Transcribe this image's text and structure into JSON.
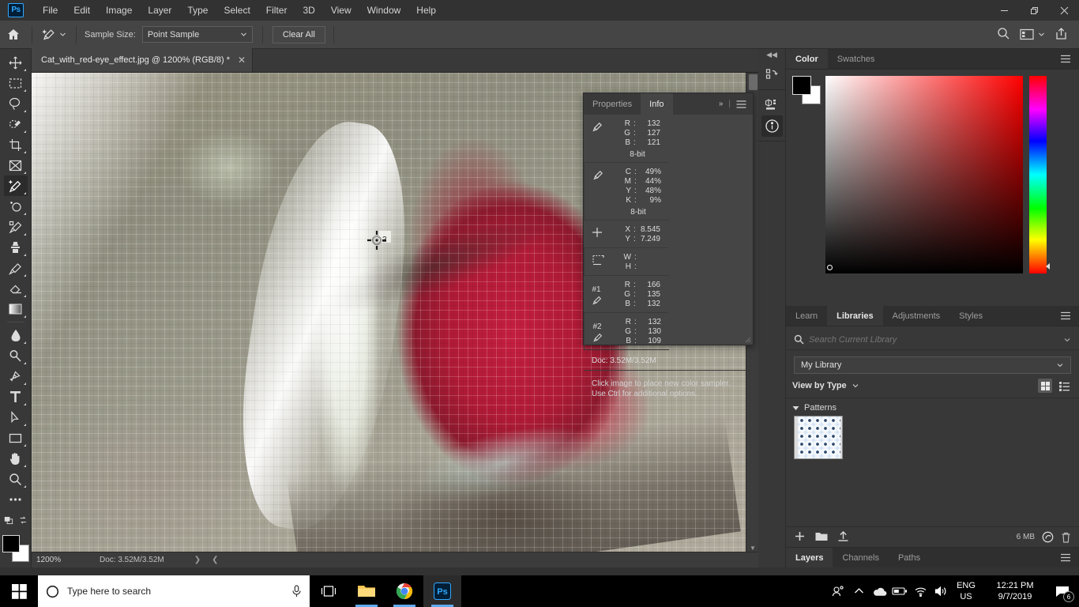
{
  "app": {
    "logo": "Ps",
    "menu": [
      "File",
      "Edit",
      "Image",
      "Layer",
      "Type",
      "Select",
      "Filter",
      "3D",
      "View",
      "Window",
      "Help"
    ],
    "window_buttons": {
      "minimize": "—",
      "restore": "❐",
      "close": "✕"
    }
  },
  "options_bar": {
    "home_icon": "home-icon",
    "tool_icon": "eyedropper-icon",
    "sample_size_label": "Sample Size:",
    "sample_size_value": "Point Sample",
    "clear_all_label": "Clear All",
    "search_icon": "search-icon",
    "workspace_icon": "workspace-icon",
    "share_icon": "share-icon"
  },
  "toolbar": {
    "tools": [
      {
        "name": "move-tool",
        "icon": "move-icon"
      },
      {
        "name": "rectangular-marquee-tool",
        "icon": "marquee-icon"
      },
      {
        "name": "lasso-tool",
        "icon": "lasso-icon"
      },
      {
        "name": "object-selection-tool",
        "icon": "quick-select-icon"
      },
      {
        "name": "crop-tool",
        "icon": "crop-icon"
      },
      {
        "name": "frame-tool",
        "icon": "frame-icon"
      },
      {
        "name": "eyedropper-tool",
        "icon": "eyedropper-icon",
        "active": true
      },
      {
        "name": "spot-healing-brush-tool",
        "icon": "healing-icon"
      },
      {
        "name": "brush-tool",
        "icon": "brush-icon"
      },
      {
        "name": "clone-stamp-tool",
        "icon": "stamp-icon"
      },
      {
        "name": "history-brush-tool",
        "icon": "history-brush-icon"
      },
      {
        "name": "eraser-tool",
        "icon": "eraser-icon"
      },
      {
        "name": "gradient-tool",
        "icon": "gradient-icon"
      },
      {
        "name": "blur-tool",
        "icon": "blur-icon"
      },
      {
        "name": "dodge-tool",
        "icon": "dodge-icon"
      },
      {
        "name": "pen-tool",
        "icon": "pen-icon"
      },
      {
        "name": "type-tool",
        "icon": "type-icon"
      },
      {
        "name": "path-selection-tool",
        "icon": "path-select-icon"
      },
      {
        "name": "rectangle-tool",
        "icon": "rectangle-icon"
      },
      {
        "name": "hand-tool",
        "icon": "hand-icon"
      },
      {
        "name": "zoom-tool",
        "icon": "zoom-icon"
      },
      {
        "name": "edit-toolbar",
        "icon": "ellipsis-icon"
      }
    ],
    "foreground_color": "#000000",
    "background_color": "#ffffff"
  },
  "document": {
    "tab_title": "Cat_with_red-eye_effect.jpg @ 1200% (RGB/8) *",
    "close_label": "✕",
    "zoom_level": "1200%",
    "doc_size": "Doc: 3.52M/3.52M",
    "sampler_label": "2"
  },
  "info_panel": {
    "tabs": [
      {
        "label": "Properties",
        "active": false
      },
      {
        "label": "Info",
        "active": true
      }
    ],
    "expand_icon": "chevron-double-right-icon",
    "menu_icon": "panel-menu-icon",
    "rgb": {
      "icon": "eyedropper-icon",
      "rows": [
        {
          "key": "R",
          "value": "132"
        },
        {
          "key": "G",
          "value": "127"
        },
        {
          "key": "B",
          "value": "121"
        }
      ],
      "depth": "8-bit"
    },
    "cmyk": {
      "icon": "eyedropper-icon",
      "rows": [
        {
          "key": "C",
          "value": "49%"
        },
        {
          "key": "M",
          "value": "44%"
        },
        {
          "key": "Y",
          "value": "48%"
        },
        {
          "key": "K",
          "value": "9%"
        }
      ],
      "depth": "8-bit"
    },
    "position": {
      "icon": "crosshair-icon",
      "rows": [
        {
          "key": "X",
          "value": "8.545"
        },
        {
          "key": "Y",
          "value": "7.249"
        }
      ]
    },
    "dimensions": {
      "icon": "selection-size-icon",
      "rows": [
        {
          "key": "W",
          "value": ""
        },
        {
          "key": "H",
          "value": ""
        }
      ]
    },
    "sampler1": {
      "label": "#1",
      "icon": "eyedropper-icon",
      "rows": [
        {
          "key": "R",
          "value": "166"
        },
        {
          "key": "G",
          "value": "135"
        },
        {
          "key": "B",
          "value": "132"
        }
      ]
    },
    "sampler2": {
      "label": "#2",
      "icon": "eyedropper-icon",
      "rows": [
        {
          "key": "R",
          "value": "132"
        },
        {
          "key": "G",
          "value": "130"
        },
        {
          "key": "B",
          "value": "109"
        }
      ]
    },
    "doc_line": "Doc: 3.52M/3.52M",
    "hint_line1": "Click image to place new color sampler.",
    "hint_line2": "Use Ctrl for additional options."
  },
  "icon_rail": {
    "collapse_icon": "collapse-panels-icon",
    "icons": [
      {
        "name": "history-actions-icon",
        "active": false
      },
      {
        "name": "3d-properties-icon",
        "active": false
      },
      {
        "name": "info-circle-icon",
        "active": true
      }
    ]
  },
  "color_panel": {
    "tabs": [
      {
        "label": "Color",
        "active": true
      },
      {
        "label": "Swatches",
        "active": false
      }
    ],
    "menu_icon": "panel-menu-icon",
    "foreground_color": "#000000",
    "background_color": "#ffffff",
    "spectrum_hue": "#ff0000"
  },
  "libraries_panel": {
    "tabs": [
      {
        "label": "Learn",
        "active": false
      },
      {
        "label": "Libraries",
        "active": true
      },
      {
        "label": "Adjustments",
        "active": false
      },
      {
        "label": "Styles",
        "active": false
      }
    ],
    "menu_icon": "panel-menu-icon",
    "search_icon": "search-icon",
    "search_value": "",
    "search_placeholder": "Search Current Library",
    "search_chevron": "chevron-down-icon",
    "library_name": "My Library",
    "view_by_label": "View by Type",
    "grid_view_icon": "grid-view-icon",
    "list_view_icon": "list-view-icon",
    "section_title": "Patterns",
    "items": [
      {
        "name": "pattern-thumbnail",
        "kind": "blue-polka-dot"
      }
    ],
    "footer": {
      "add_icon": "add-icon",
      "folder_icon": "folder-icon",
      "upload_icon": "upload-icon",
      "size_label": "6 MB",
      "cloud_icon": "creative-cloud-icon",
      "delete_icon": "trash-icon"
    }
  },
  "layers_panel": {
    "tabs": [
      {
        "label": "Layers",
        "active": true
      },
      {
        "label": "Channels",
        "active": false
      },
      {
        "label": "Paths",
        "active": false
      }
    ],
    "menu_icon": "panel-menu-icon"
  },
  "taskbar": {
    "start_icon": "windows-start-icon",
    "search_icon": "cortana-circle-icon",
    "search_placeholder": "Type here to search",
    "mic_icon": "microphone-icon",
    "taskview_icon": "task-view-icon",
    "apps": [
      {
        "name": "file-explorer-icon"
      },
      {
        "name": "chrome-icon"
      },
      {
        "name": "photoshop-icon",
        "active": true
      }
    ],
    "tray": [
      {
        "name": "people-icon"
      },
      {
        "name": "show-hidden-icons-icon"
      },
      {
        "name": "onedrive-icon"
      },
      {
        "name": "battery-icon"
      },
      {
        "name": "wifi-icon"
      },
      {
        "name": "volume-icon"
      }
    ],
    "language_line1": "ENG",
    "language_line2": "US",
    "clock_time": "12:21 PM",
    "clock_date": "9/7/2019",
    "notification_icon": "action-center-icon",
    "notification_count": "6"
  }
}
